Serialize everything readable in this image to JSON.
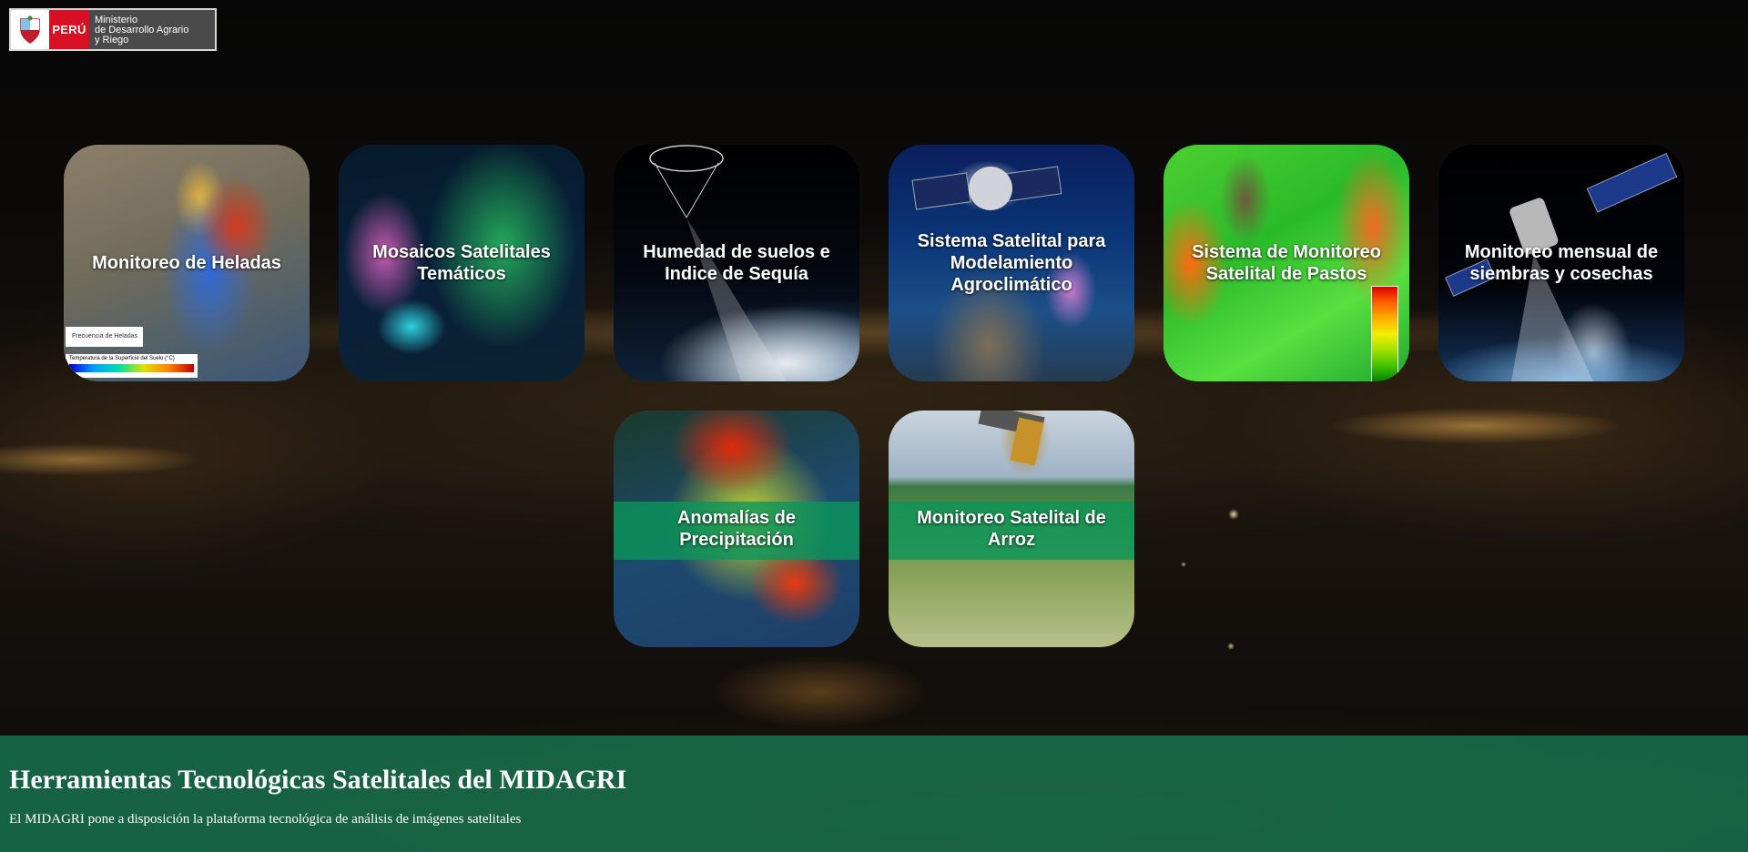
{
  "logo": {
    "country": "PERÚ",
    "ministry_line1": "Ministerio",
    "ministry_line2": "de Desarrollo Agrario",
    "ministry_line3": "y Riego"
  },
  "tiles": [
    {
      "label": "Monitoreo de Heladas",
      "legend_top": "Frecuencia de Heladas",
      "legend_bottom": "Temperatura de la Superficie del Suelo (°C)"
    },
    {
      "label": "Mosaicos Satelitales Temáticos"
    },
    {
      "label": "Humedad de suelos e Indice de Sequía"
    },
    {
      "label": "Sistema Satelital para Modelamiento Agroclimático"
    },
    {
      "label": "Sistema de Monitoreo Satelital de Pastos"
    },
    {
      "label": "Monitoreo mensual de siembras y cosechas"
    },
    {
      "label": "Anomalías de Precipitación"
    },
    {
      "label": "Monitoreo Satelital de Arroz"
    }
  ],
  "footer": {
    "title": "Herramientas Tecnológicas Satelitales del MIDAGRI",
    "subtitle": "El MIDAGRI pone a disposición la plataforma tecnológica de análisis de imágenes satelitales"
  }
}
